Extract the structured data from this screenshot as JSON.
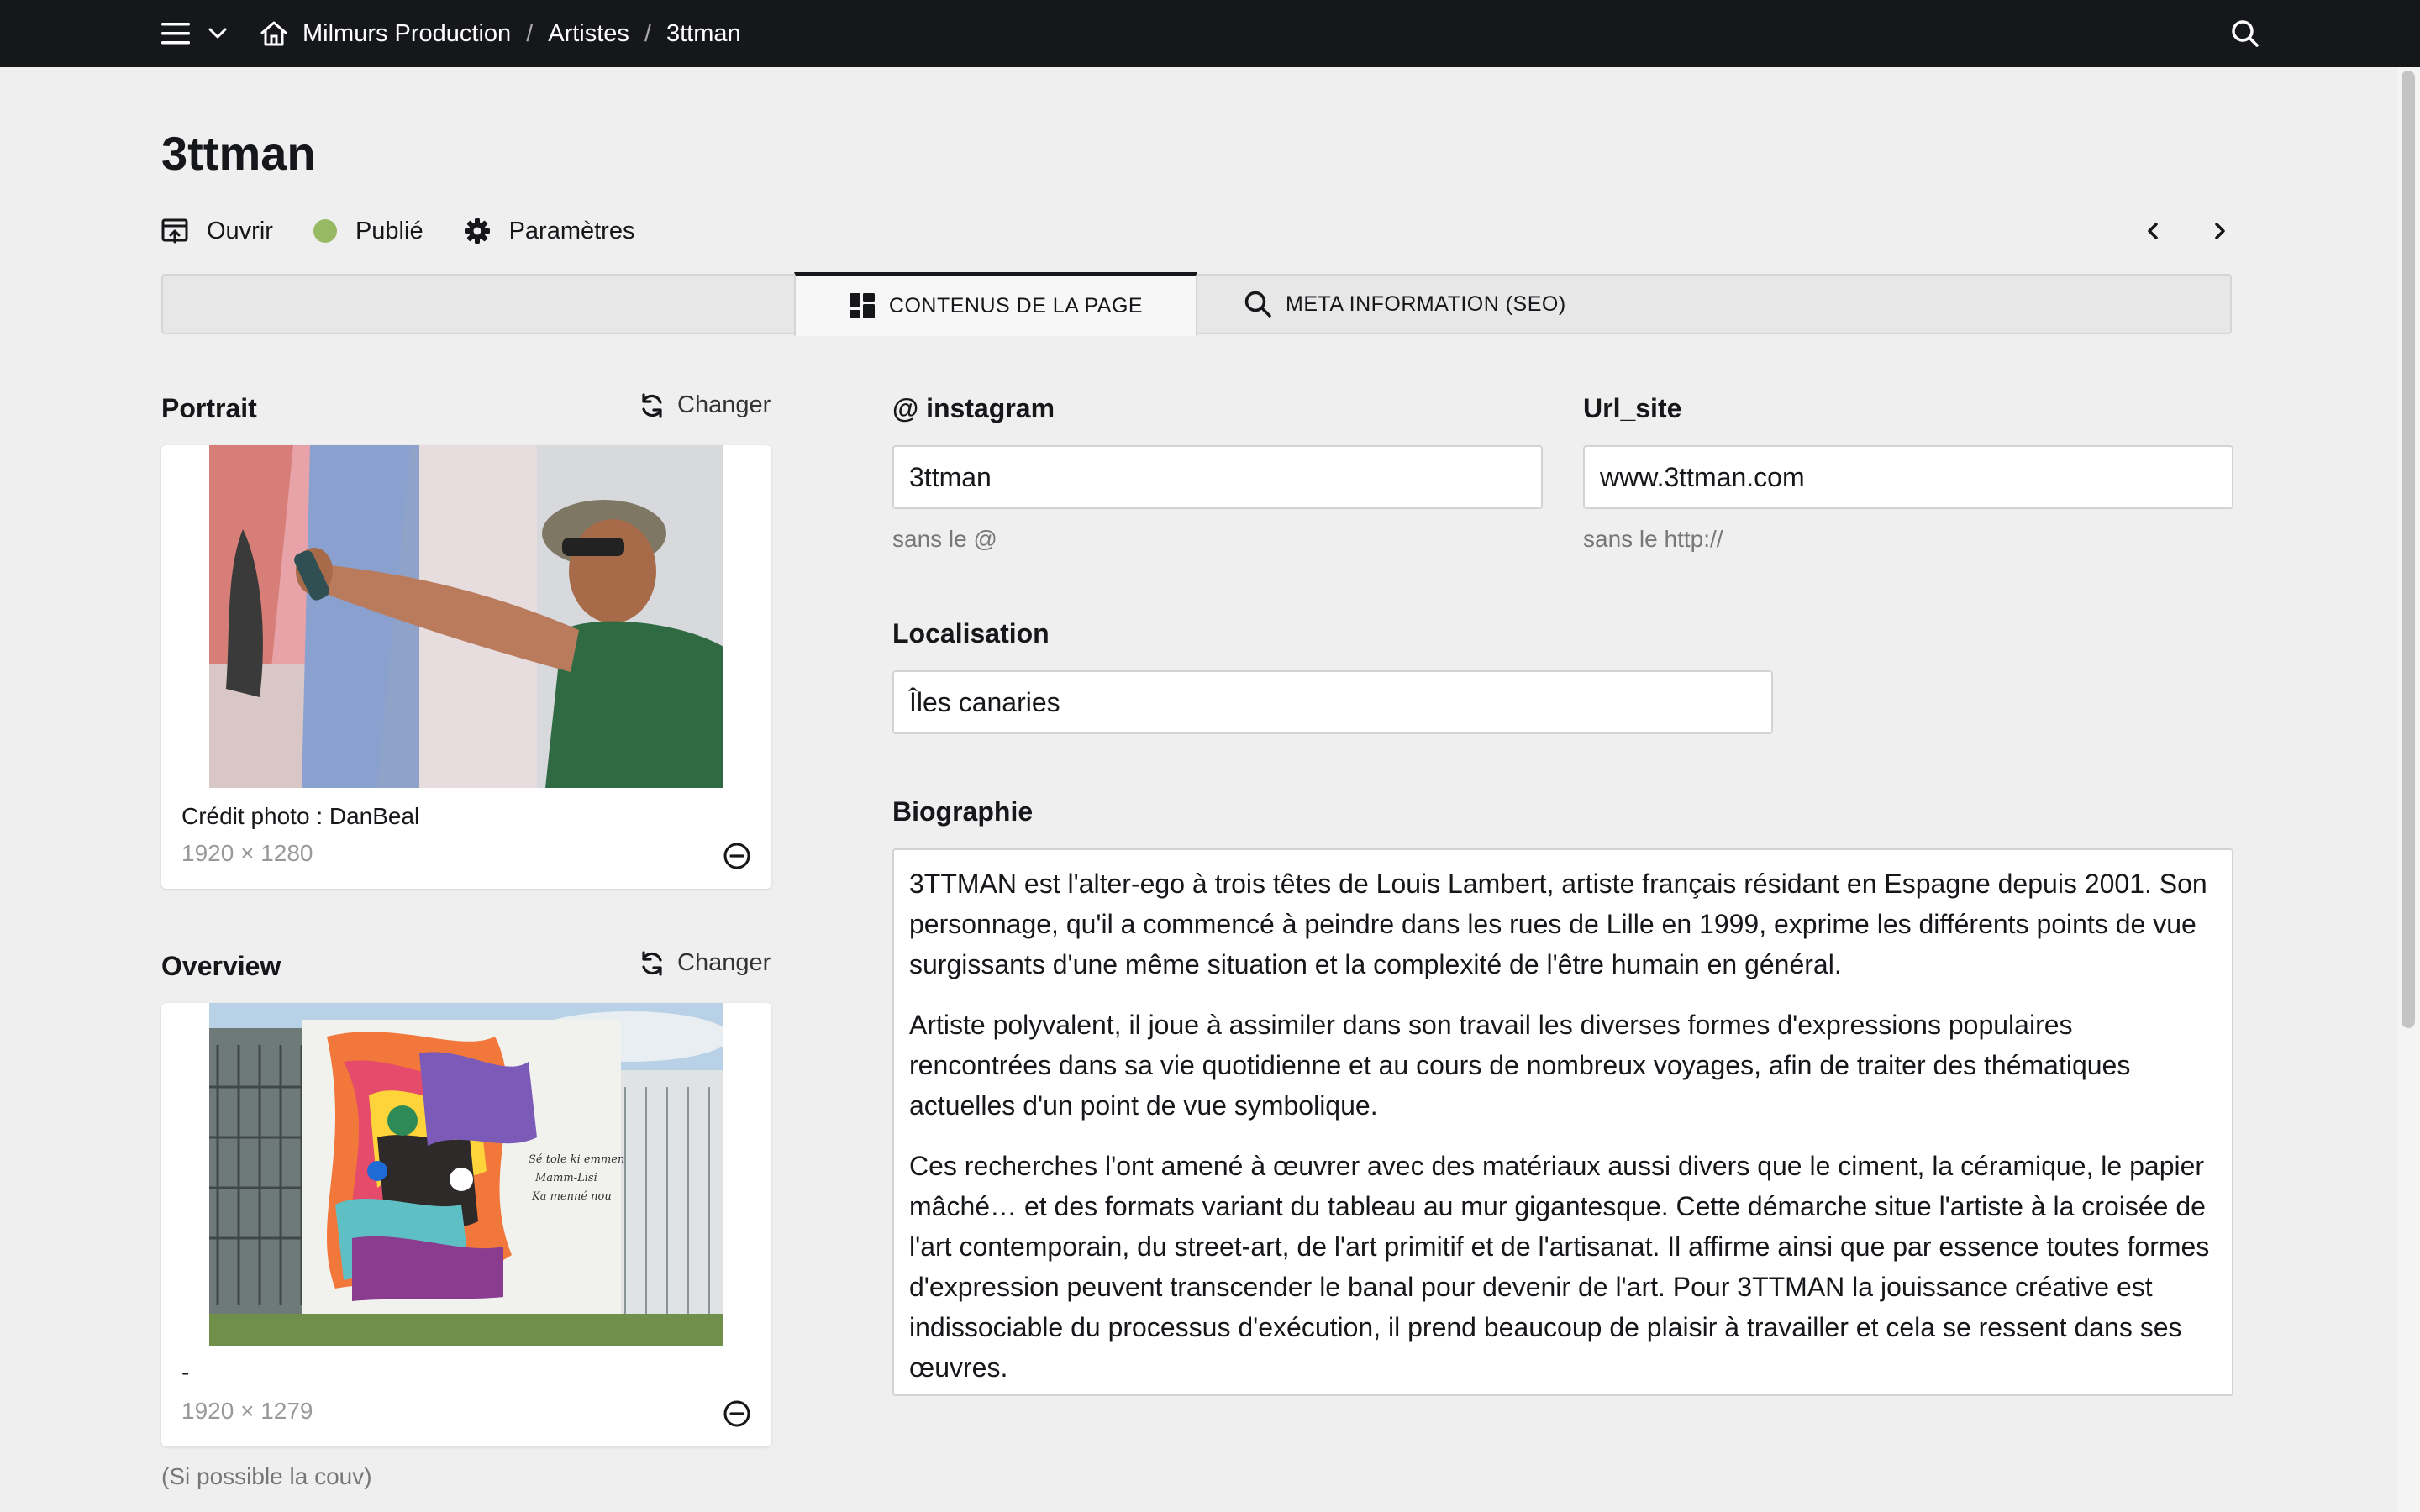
{
  "breadcrumb": {
    "home": "Milmurs Production",
    "section": "Artistes",
    "current": "3ttman"
  },
  "page": {
    "title": "3ttman"
  },
  "actions": {
    "open": "Ouvrir",
    "status": "Publié",
    "settings": "Paramètres"
  },
  "tabs": {
    "content": "CONTENUS DE LA PAGE",
    "seo": "META INFORMATION (SEO)"
  },
  "portrait": {
    "label": "Portrait",
    "change": "Changer",
    "caption": "Crédit photo : DanBeal",
    "dims": "1920 × 1280"
  },
  "overview": {
    "label": "Overview",
    "change": "Changer",
    "caption": "-",
    "dims": "1920 × 1279",
    "help": "(Si possible la couv)",
    "mural_text": [
      "Sé tole ki emmen",
      "Mamm-Lisi",
      "Ka menné nou"
    ]
  },
  "instagram": {
    "label": "@ instagram",
    "value": "3ttman",
    "help": "sans le @"
  },
  "url_site": {
    "label": "Url_site",
    "value": "www.3ttman.com",
    "help": "sans le http://"
  },
  "localisation": {
    "label": "Localisation",
    "value": "Îles canaries"
  },
  "biographie": {
    "label": "Biographie",
    "paragraphs": [
      "3TTMAN est l'alter-ego à trois têtes de Louis Lambert, artiste français résidant en Espagne depuis 2001. Son personnage, qu'il a commencé à peindre dans les rues de Lille en 1999, exprime les différents points de vue surgissants d'une même situation et la complexité de l'être humain en général.",
      "Artiste polyvalent, il joue à assimiler dans son travail les diverses formes d'expressions populaires rencontrées dans sa vie quotidienne et au cours de nombreux voyages, afin de traiter des thématiques actuelles d'un point de vue symbolique.",
      "Ces recherches l'ont amené à œuvrer avec des matériaux aussi divers que le ciment, la céramique, le papier mâché… et des formats variant du tableau au mur gigantesque. Cette démarche situe l'artiste à la croisée de l'art contemporain, du street-art, de l'art primitif et de l'artisanat. Il affirme ainsi que par essence toutes formes d'expression peuvent transcender le banal pour devenir de l'art. Pour 3TTMAN la jouissance créative est indissociable du processus d'exécution, il prend beaucoup de plaisir à travailler et cela se ressent dans ses œuvres."
    ]
  },
  "colors": {
    "topbar": "#16171a",
    "background": "#efefef",
    "status_published": "#98b963"
  }
}
